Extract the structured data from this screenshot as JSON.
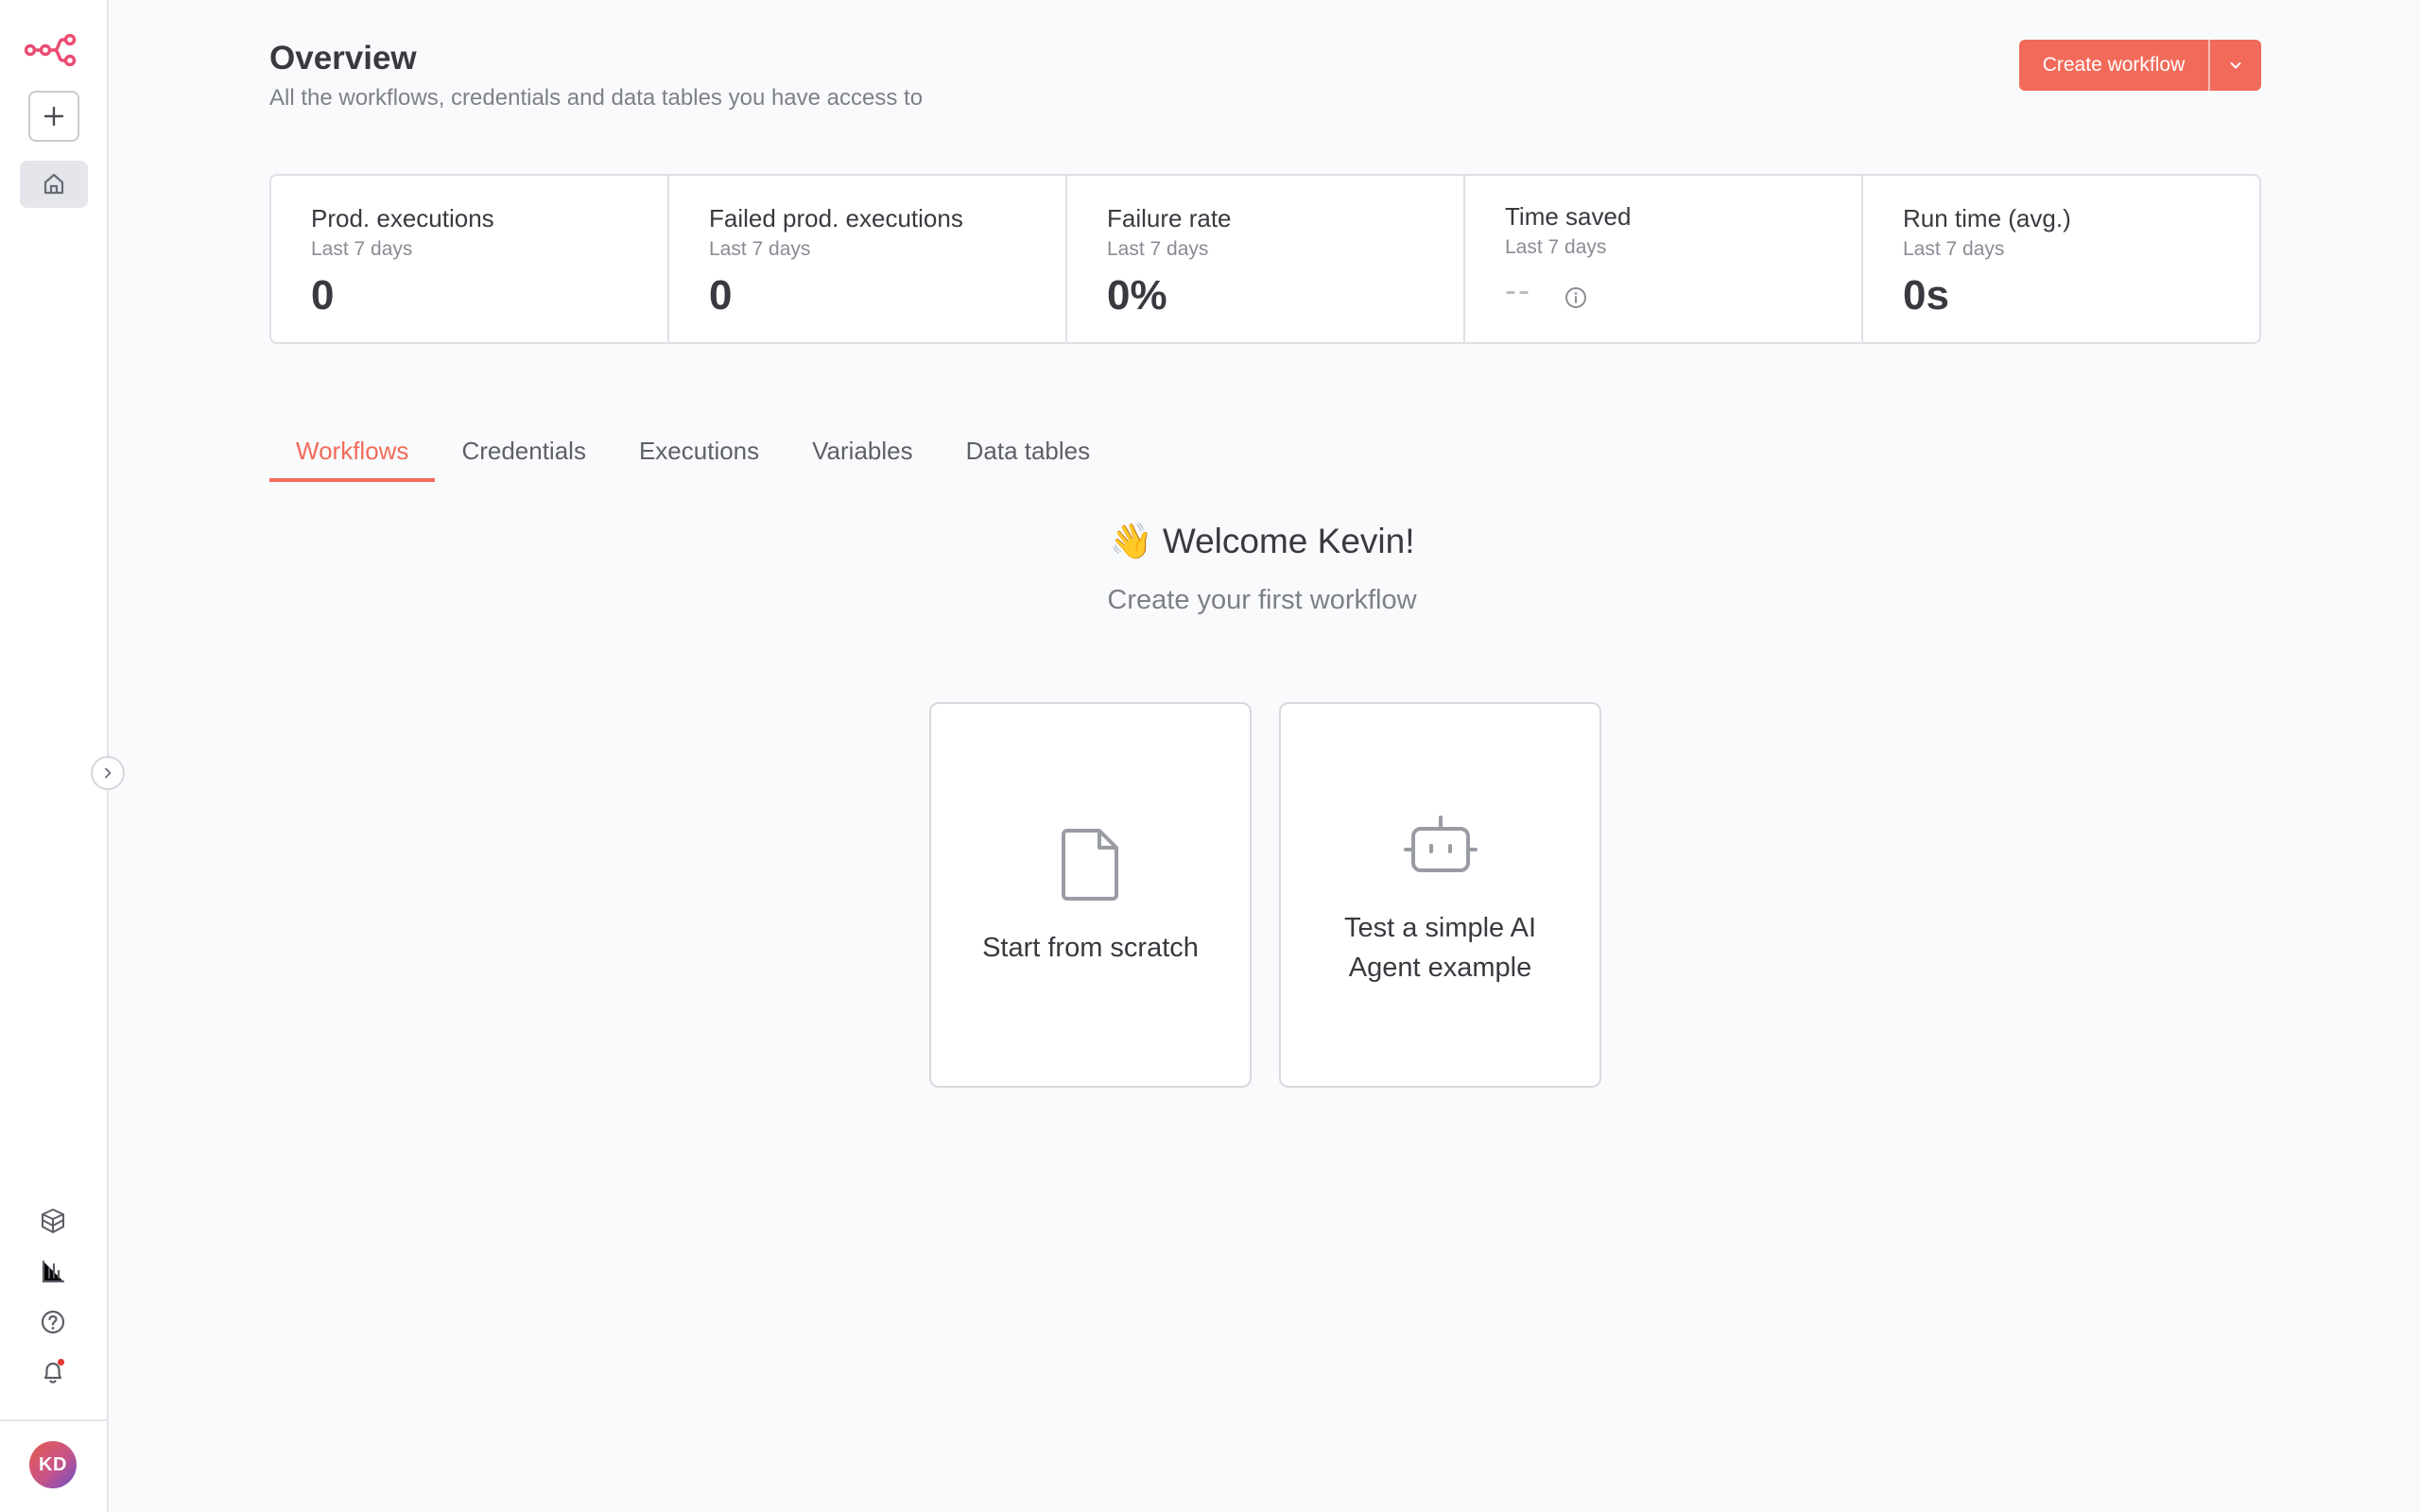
{
  "sidebar": {
    "logo_icon": "n8n-logo",
    "new_icon": "plus-icon",
    "home_icon": "home-icon",
    "bottom_icons": [
      "templates-icon",
      "insights-chart-icon",
      "help-icon",
      "bell-icon"
    ],
    "avatar_initials": "KD"
  },
  "header": {
    "title": "Overview",
    "subtitle": "All the workflows, credentials and data tables you have access to",
    "create_label": "Create workflow"
  },
  "stats": [
    {
      "label": "Prod. executions",
      "period": "Last 7 days",
      "value": "0"
    },
    {
      "label": "Failed prod. executions",
      "period": "Last 7 days",
      "value": "0"
    },
    {
      "label": "Failure rate",
      "period": "Last 7 days",
      "value": "0%"
    },
    {
      "label": "Time saved",
      "period": "Last 7 days",
      "value": "--"
    },
    {
      "label": "Run time (avg.)",
      "period": "Last 7 days",
      "value": "0s"
    }
  ],
  "tabs": [
    "Workflows",
    "Credentials",
    "Executions",
    "Variables",
    "Data tables"
  ],
  "welcome": {
    "title": "👋 Welcome Kevin!",
    "subtitle": "Create your first workflow"
  },
  "cards": {
    "scratch_label": "Start from scratch",
    "ai_label_line1": "Test a simple AI",
    "ai_label_line2": "Agent example"
  },
  "colors": {
    "accent": "#f26b5a",
    "logo": "#ea4b71",
    "notification_dot": "#e53935"
  }
}
